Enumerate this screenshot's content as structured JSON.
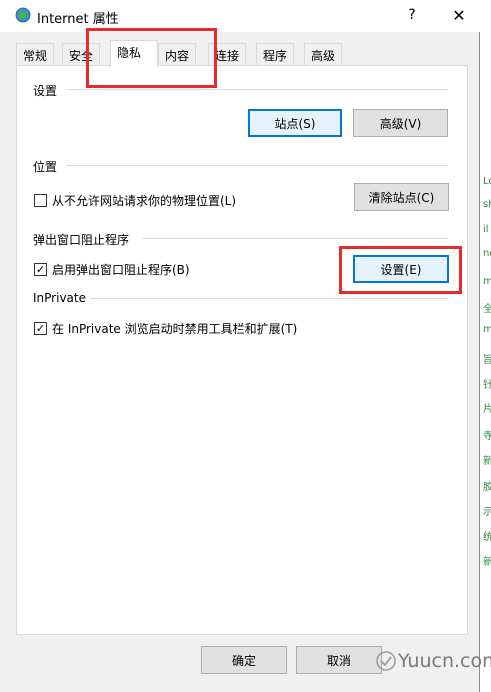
{
  "window": {
    "title": "Internet 属性",
    "help_glyph": "?",
    "close_glyph": "✕"
  },
  "tabs": [
    {
      "label": "常规",
      "active": false
    },
    {
      "label": "安全",
      "active": false
    },
    {
      "label": "隐私",
      "active": true
    },
    {
      "label": "内容",
      "active": false
    },
    {
      "label": "连接",
      "active": false
    },
    {
      "label": "程序",
      "active": false
    },
    {
      "label": "高级",
      "active": false
    }
  ],
  "settings_group": {
    "label": "设置",
    "sites_button": "站点(S)",
    "advanced_button": "高级(V)"
  },
  "location_group": {
    "label": "位置",
    "checkbox_label": "从不允许网站请求你的物理位置(L)",
    "checked": false,
    "clear_button": "清除站点(C)"
  },
  "popup_group": {
    "label": "弹出窗口阻止程序",
    "checkbox_label": "启用弹出窗口阻止程序(B)",
    "checked": true,
    "settings_button": "设置(E)"
  },
  "inprivate_group": {
    "label": "InPrivate",
    "checkbox_label": "在 InPrivate 浏览启动时禁用工具栏和扩展(T)",
    "checked": true
  },
  "footer": {
    "ok_button": "确定",
    "cancel_button": "取消"
  },
  "background_fragments": [
    "Lo",
    "sh",
    "il",
    "ne",
    "m",
    "全",
    "m",
    "旨",
    "针",
    "片",
    "寺",
    "新",
    "胶",
    "示",
    "统",
    "新"
  ],
  "watermark": "Yuucn.com",
  "colors": {
    "highlight": "#e52b2b",
    "primary_border": "#0078d7",
    "link_green": "#2e8b3a"
  }
}
